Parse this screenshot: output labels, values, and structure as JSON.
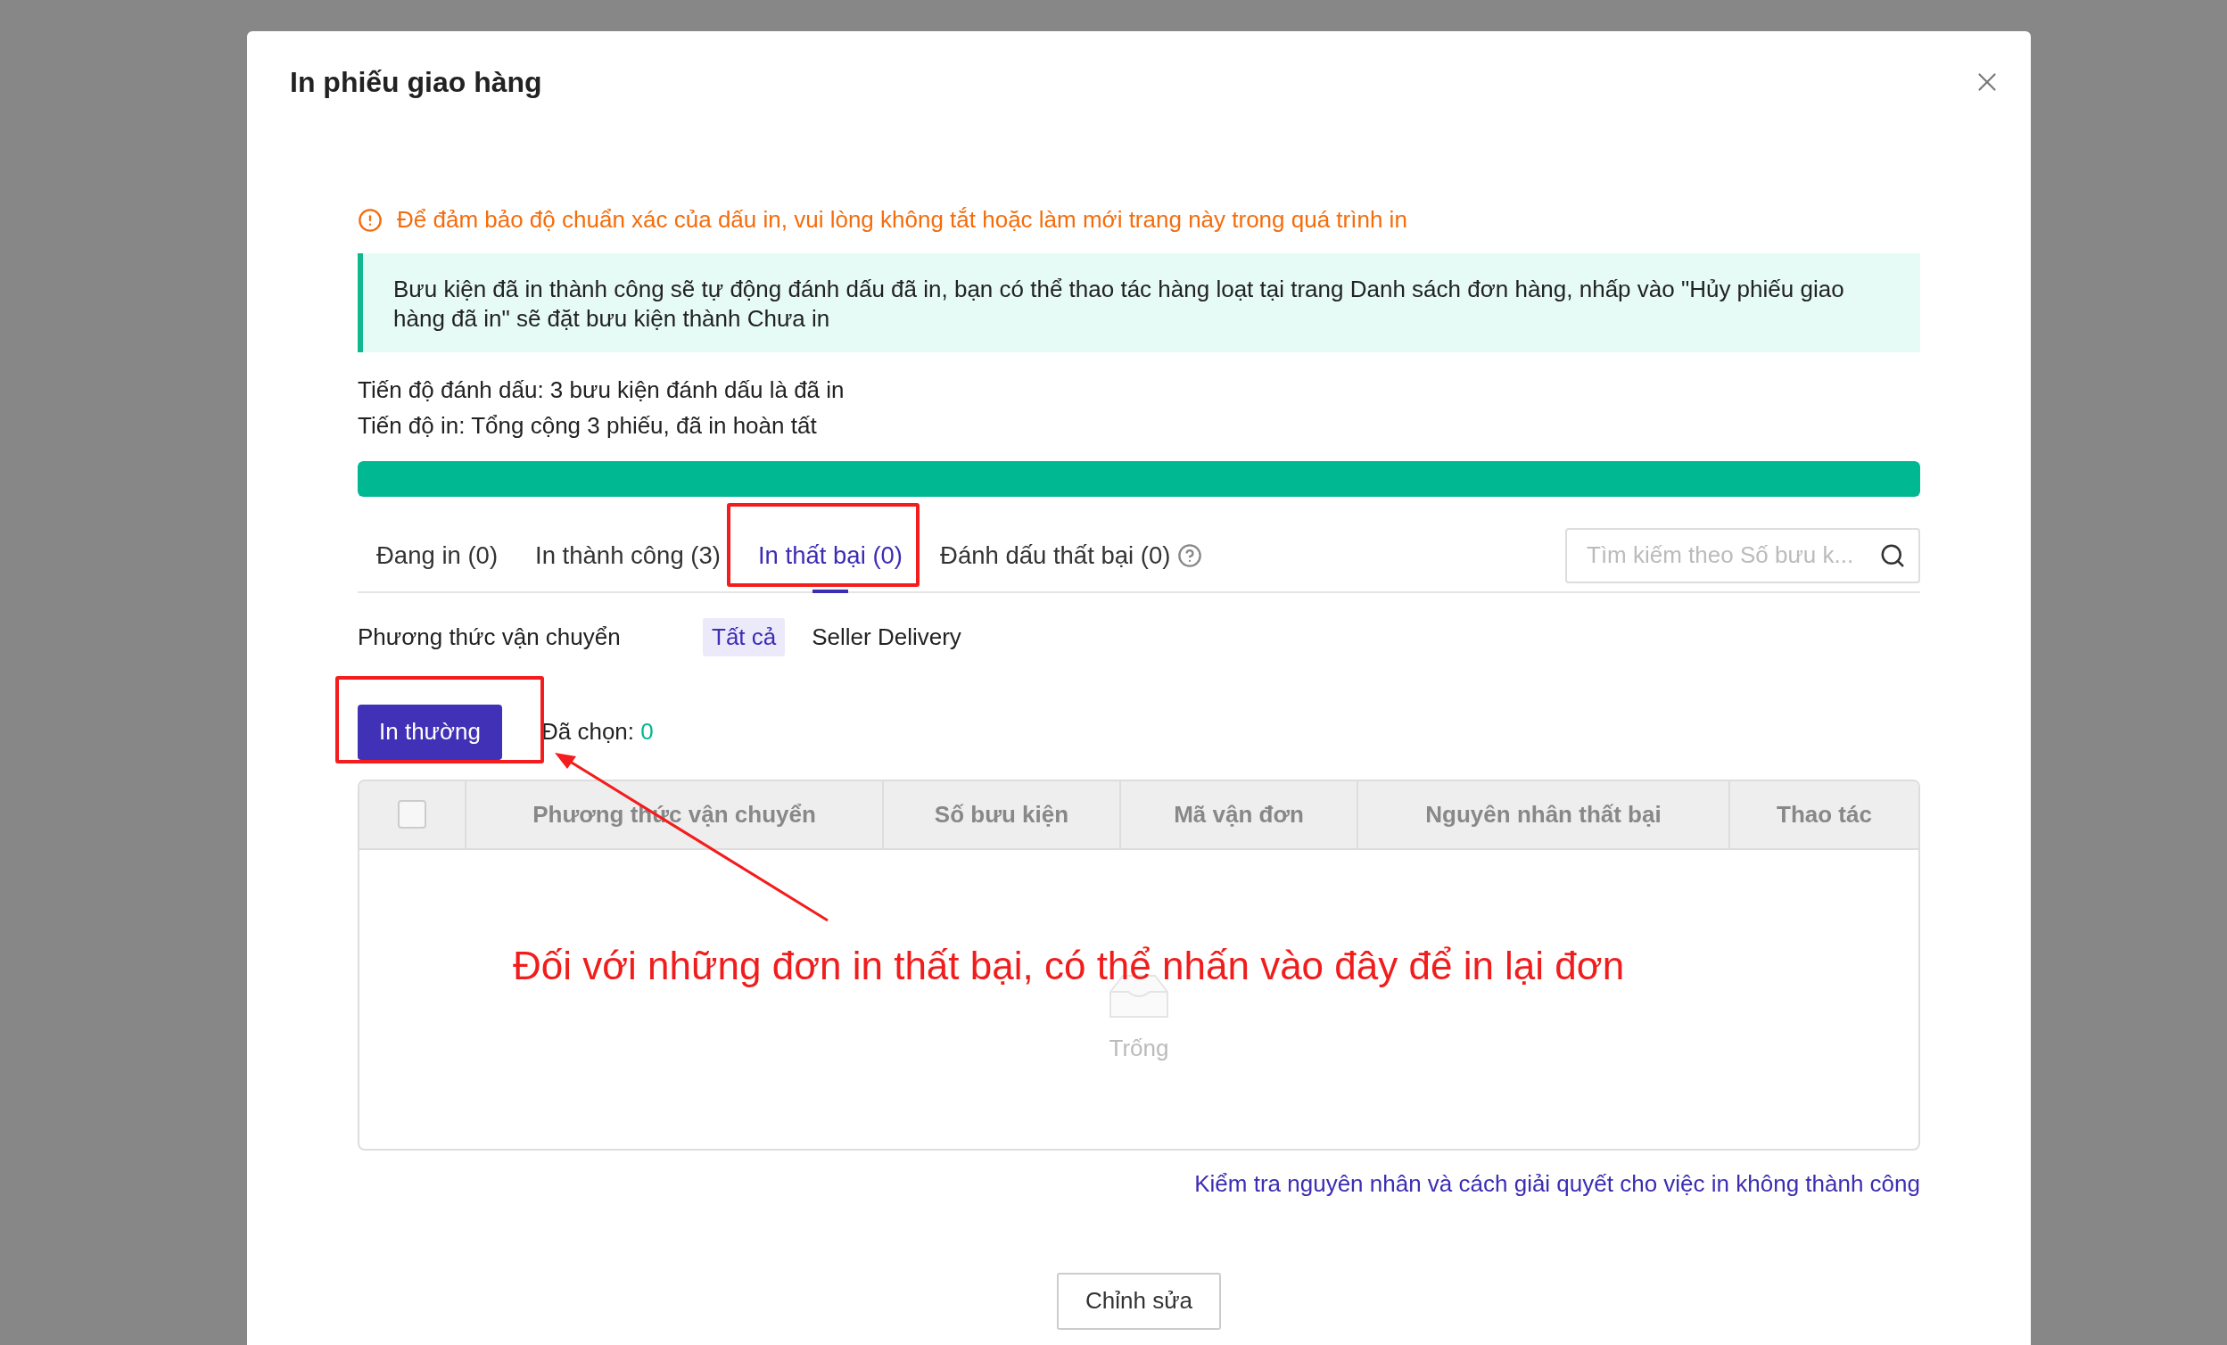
{
  "dialog": {
    "title": "In phiếu giao hàng"
  },
  "warning": "Để đảm bảo độ chuẩn xác của dấu in, vui lòng không tắt hoặc làm mới trang này trong quá trình in",
  "notice": "Bưu kiện đã in thành công sẽ tự động đánh dấu đã in, bạn có thể thao tác hàng loạt tại trang Danh sách đơn hàng, nhấp vào \"Hủy phiếu giao hàng đã in\" sẽ đặt bưu kiện thành Chưa in",
  "progress": {
    "lines": [
      "Tiến độ đánh dấu: 3 bưu kiện đánh dấu là đã in",
      "Tiến độ in: Tổng cộng 3 phiếu, đã in hoàn tất"
    ],
    "level": 1
  },
  "tabs": [
    {
      "label": "Đang in (0)",
      "selected": false,
      "help": false
    },
    {
      "label": "In thành công (3)",
      "selected": false,
      "help": false
    },
    {
      "label": "In thất bại (0)",
      "selected": true,
      "help": false
    },
    {
      "label": "Đánh dấu thất bại (0)",
      "selected": false,
      "help": true
    }
  ],
  "search": {
    "placeholder": "Tìm kiếm theo Số bưu k..."
  },
  "filter": {
    "label": "Phương thức vận chuyển",
    "options": [
      {
        "label": "Tất cả",
        "selected": true
      },
      {
        "label": "Seller Delivery",
        "selected": false
      }
    ]
  },
  "actions": {
    "button": "In thường",
    "selected_label": "Đã chọn:",
    "selected_count": "0"
  },
  "table": {
    "select_all_checked": false,
    "columns": [
      "Phương thức vận chuyển",
      "Số bưu kiện",
      "Mã vận đơn",
      "Nguyên nhân thất bại",
      "Thao tác"
    ],
    "empty_text": "Trống"
  },
  "help_link": "Kiểm tra nguyên nhân và cách giải quyết cho việc in không thành công",
  "footer": {
    "button": "Chỉnh sửa"
  },
  "annotation": {
    "text": "Đối với những đơn in thất bại, có thể nhấn vào đây để in lại đơn"
  }
}
